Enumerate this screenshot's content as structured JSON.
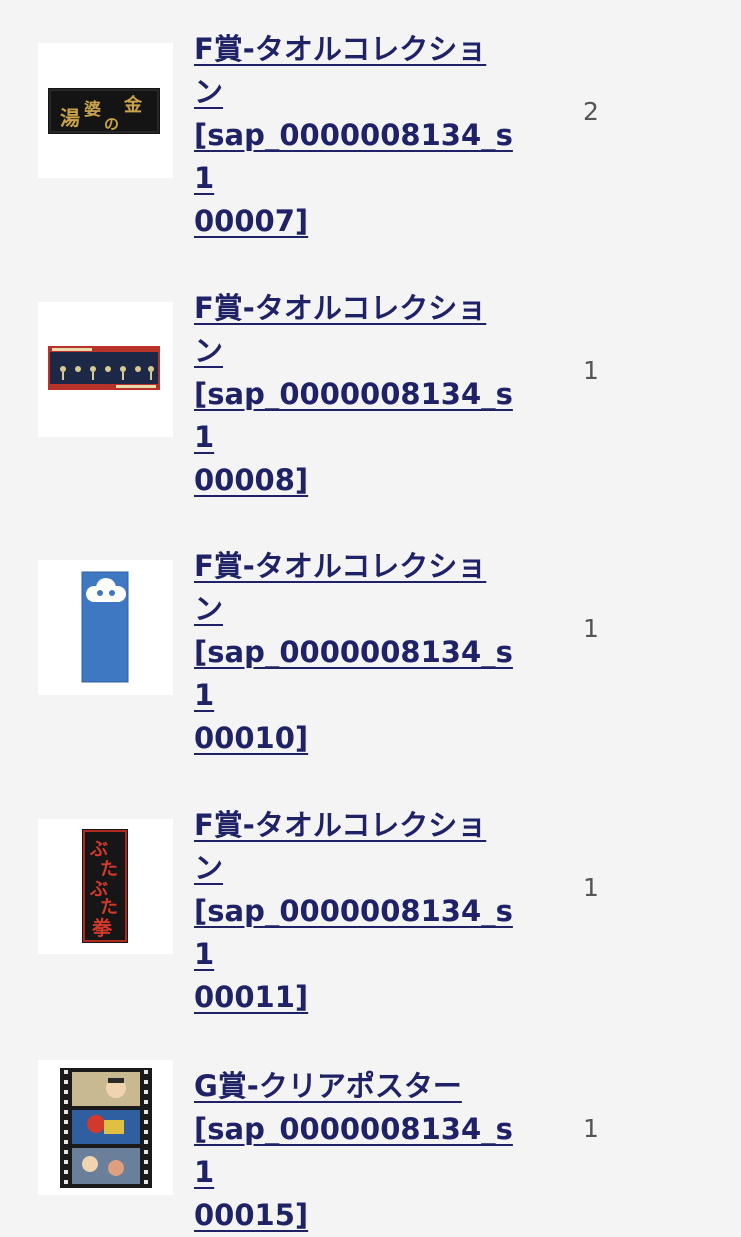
{
  "items": [
    {
      "title_lines": [
        "F賞-タオルコレクショ",
        "ン",
        "[sap_0000008134_s1",
        "00007]"
      ],
      "quantity": "2",
      "thumbnail_icon": "black-towel-gold-kanji-image",
      "thumbnail_text": [
        "湯",
        "婆",
        "の",
        "金"
      ]
    },
    {
      "title_lines": [
        "F賞-タオルコレクショ",
        "ン",
        "[sap_0000008134_s1",
        "00008]"
      ],
      "quantity": "1",
      "thumbnail_icon": "navy-towel-red-border-image"
    },
    {
      "title_lines": [
        "F賞-タオルコレクショ",
        "ン",
        "[sap_0000008134_s1",
        "00010]"
      ],
      "quantity": "1",
      "thumbnail_icon": "blue-towel-cloud-image"
    },
    {
      "title_lines": [
        "F賞-タオルコレクショ",
        "ン",
        "[sap_0000008134_s1",
        "00011]"
      ],
      "quantity": "1",
      "thumbnail_icon": "black-towel-red-lettering-image",
      "thumbnail_text": [
        "ぶ",
        "た",
        "ぶ",
        "た",
        "拳"
      ]
    },
    {
      "title_lines": [
        "G賞-クリアポスター",
        "[sap_0000008134_s1",
        "00015]"
      ],
      "quantity": "1",
      "thumbnail_icon": "film-strip-poster-image"
    }
  ],
  "colors": {
    "background": "#f4f4f5",
    "link": "#1f2266",
    "quantity": "#555555"
  }
}
